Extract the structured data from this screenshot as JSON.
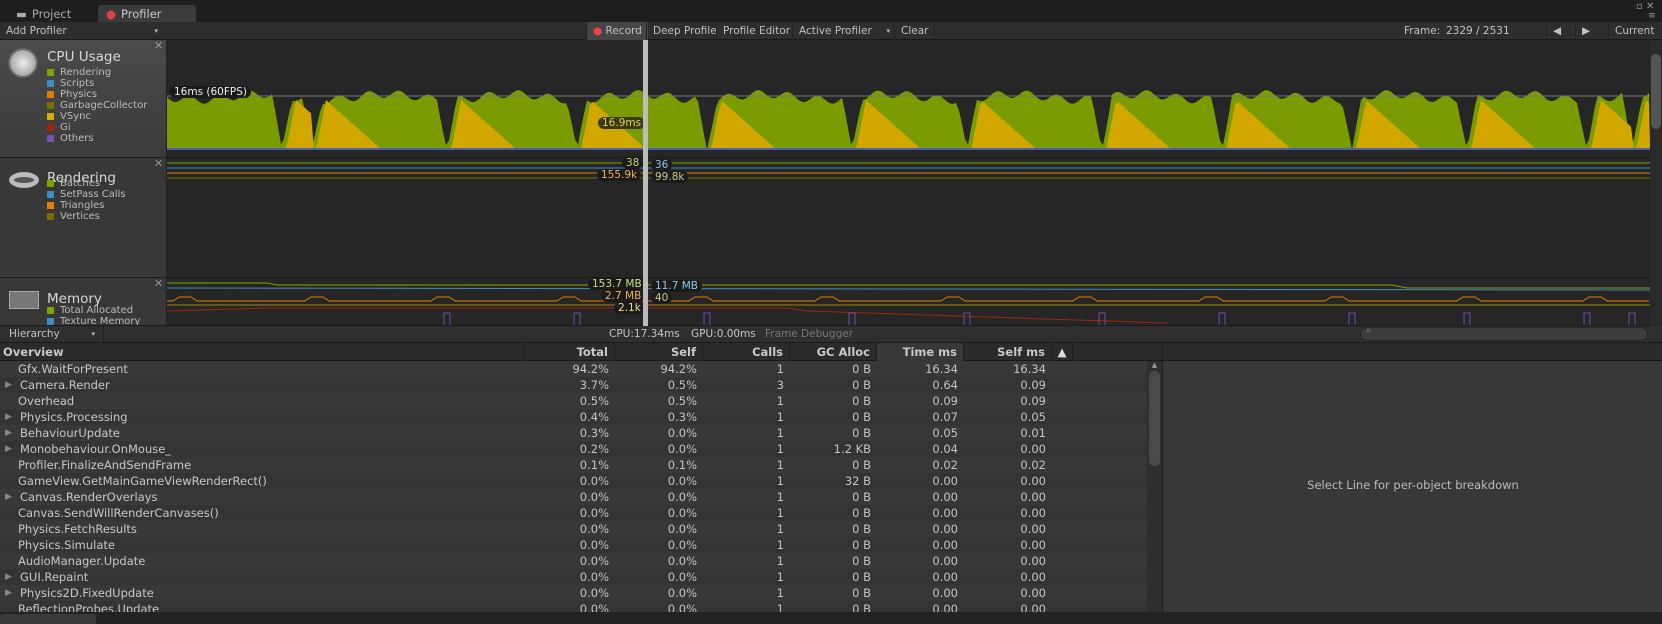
{
  "tabs": [
    {
      "label": "Project",
      "icon": "folder-icon"
    },
    {
      "label": "Profiler",
      "icon": "profiler-icon",
      "active": true
    }
  ],
  "toolbar": {
    "add_profiler": "Add Profiler",
    "record": "Record",
    "deep_profile": "Deep Profile",
    "profile_editor": "Profile Editor",
    "active_profiler": "Active Profiler",
    "clear": "Clear",
    "frame_label": "Frame:",
    "frame_value": "2329 / 2531",
    "current": "Current"
  },
  "panels": {
    "cpu": {
      "title": "CPU Usage",
      "legend": [
        {
          "label": "Rendering",
          "color": "#7ea500"
        },
        {
          "label": "Scripts",
          "color": "#3b8ec2"
        },
        {
          "label": "Physics",
          "color": "#e08000"
        },
        {
          "label": "GarbageCollector",
          "color": "#7a7000"
        },
        {
          "label": "VSync",
          "color": "#d8b000"
        },
        {
          "label": "Gi",
          "color": "#a0250a"
        },
        {
          "label": "Others",
          "color": "#7a50b0"
        }
      ],
      "target_label": "16ms (60FPS)",
      "selected_value": "16.9ms"
    },
    "rendering": {
      "title": "Rendering",
      "legend": [
        {
          "label": "Batches",
          "color": "#7ea500"
        },
        {
          "label": "SetPass Calls",
          "color": "#3b8ec2"
        },
        {
          "label": "Triangles",
          "color": "#e08000"
        },
        {
          "label": "Vertices",
          "color": "#7a7000"
        }
      ],
      "values": {
        "batches": "38",
        "setpass": "36",
        "triangles": "155.9k",
        "vertices": "99.8k"
      }
    },
    "memory": {
      "title": "Memory",
      "legend": [
        {
          "label": "Total Allocated",
          "color": "#7ea500"
        },
        {
          "label": "Texture Memory",
          "color": "#3b8ec2"
        }
      ],
      "values": {
        "total": "153.7 MB",
        "texture": "11.7 MB",
        "v3": "2.7 MB",
        "v4": "40",
        "v5": "2.1k"
      }
    }
  },
  "hierarchy": {
    "view": "Hierarchy",
    "cpu": "CPU:17.34ms",
    "gpu": "GPU:0.00ms",
    "frame_debugger": "Frame Debugger",
    "columns": [
      "Overview",
      "Total",
      "Self",
      "Calls",
      "GC Alloc",
      "Time ms",
      "Self ms"
    ],
    "rows": [
      {
        "name": "Gfx.WaitForPresent",
        "exp": false,
        "v": [
          "94.2%",
          "94.2%",
          "1",
          "0 B",
          "16.34",
          "16.34"
        ]
      },
      {
        "name": "Camera.Render",
        "exp": true,
        "v": [
          "3.7%",
          "0.5%",
          "3",
          "0 B",
          "0.64",
          "0.09"
        ]
      },
      {
        "name": "Overhead",
        "exp": false,
        "v": [
          "0.5%",
          "0.5%",
          "1",
          "0 B",
          "0.09",
          "0.09"
        ]
      },
      {
        "name": "Physics.Processing",
        "exp": true,
        "v": [
          "0.4%",
          "0.3%",
          "1",
          "0 B",
          "0.07",
          "0.05"
        ]
      },
      {
        "name": "BehaviourUpdate",
        "exp": true,
        "v": [
          "0.3%",
          "0.0%",
          "1",
          "0 B",
          "0.05",
          "0.01"
        ]
      },
      {
        "name": "Monobehaviour.OnMouse_",
        "exp": true,
        "v": [
          "0.2%",
          "0.0%",
          "1",
          "1.2 KB",
          "0.04",
          "0.00"
        ]
      },
      {
        "name": "Profiler.FinalizeAndSendFrame",
        "exp": false,
        "v": [
          "0.1%",
          "0.1%",
          "1",
          "0 B",
          "0.02",
          "0.02"
        ]
      },
      {
        "name": "GameView.GetMainGameViewRenderRect()",
        "exp": false,
        "v": [
          "0.0%",
          "0.0%",
          "1",
          "32 B",
          "0.00",
          "0.00"
        ]
      },
      {
        "name": "Canvas.RenderOverlays",
        "exp": true,
        "v": [
          "0.0%",
          "0.0%",
          "1",
          "0 B",
          "0.00",
          "0.00"
        ]
      },
      {
        "name": "Canvas.SendWillRenderCanvases()",
        "exp": false,
        "v": [
          "0.0%",
          "0.0%",
          "1",
          "0 B",
          "0.00",
          "0.00"
        ]
      },
      {
        "name": "Physics.FetchResults",
        "exp": false,
        "v": [
          "0.0%",
          "0.0%",
          "1",
          "0 B",
          "0.00",
          "0.00"
        ]
      },
      {
        "name": "Physics.Simulate",
        "exp": false,
        "v": [
          "0.0%",
          "0.0%",
          "1",
          "0 B",
          "0.00",
          "0.00"
        ]
      },
      {
        "name": "AudioManager.Update",
        "exp": false,
        "v": [
          "0.0%",
          "0.0%",
          "1",
          "0 B",
          "0.00",
          "0.00"
        ]
      },
      {
        "name": "GUI.Repaint",
        "exp": true,
        "v": [
          "0.0%",
          "0.0%",
          "1",
          "0 B",
          "0.00",
          "0.00"
        ]
      },
      {
        "name": "Physics2D.FixedUpdate",
        "exp": true,
        "v": [
          "0.0%",
          "0.0%",
          "1",
          "0 B",
          "0.00",
          "0.00"
        ]
      },
      {
        "name": "ReflectionProbes.Update",
        "exp": false,
        "v": [
          "0.0%",
          "0.0%",
          "1",
          "0 B",
          "0.00",
          "0.00"
        ]
      }
    ],
    "detail_hint": "Select Line for per-object breakdown"
  }
}
